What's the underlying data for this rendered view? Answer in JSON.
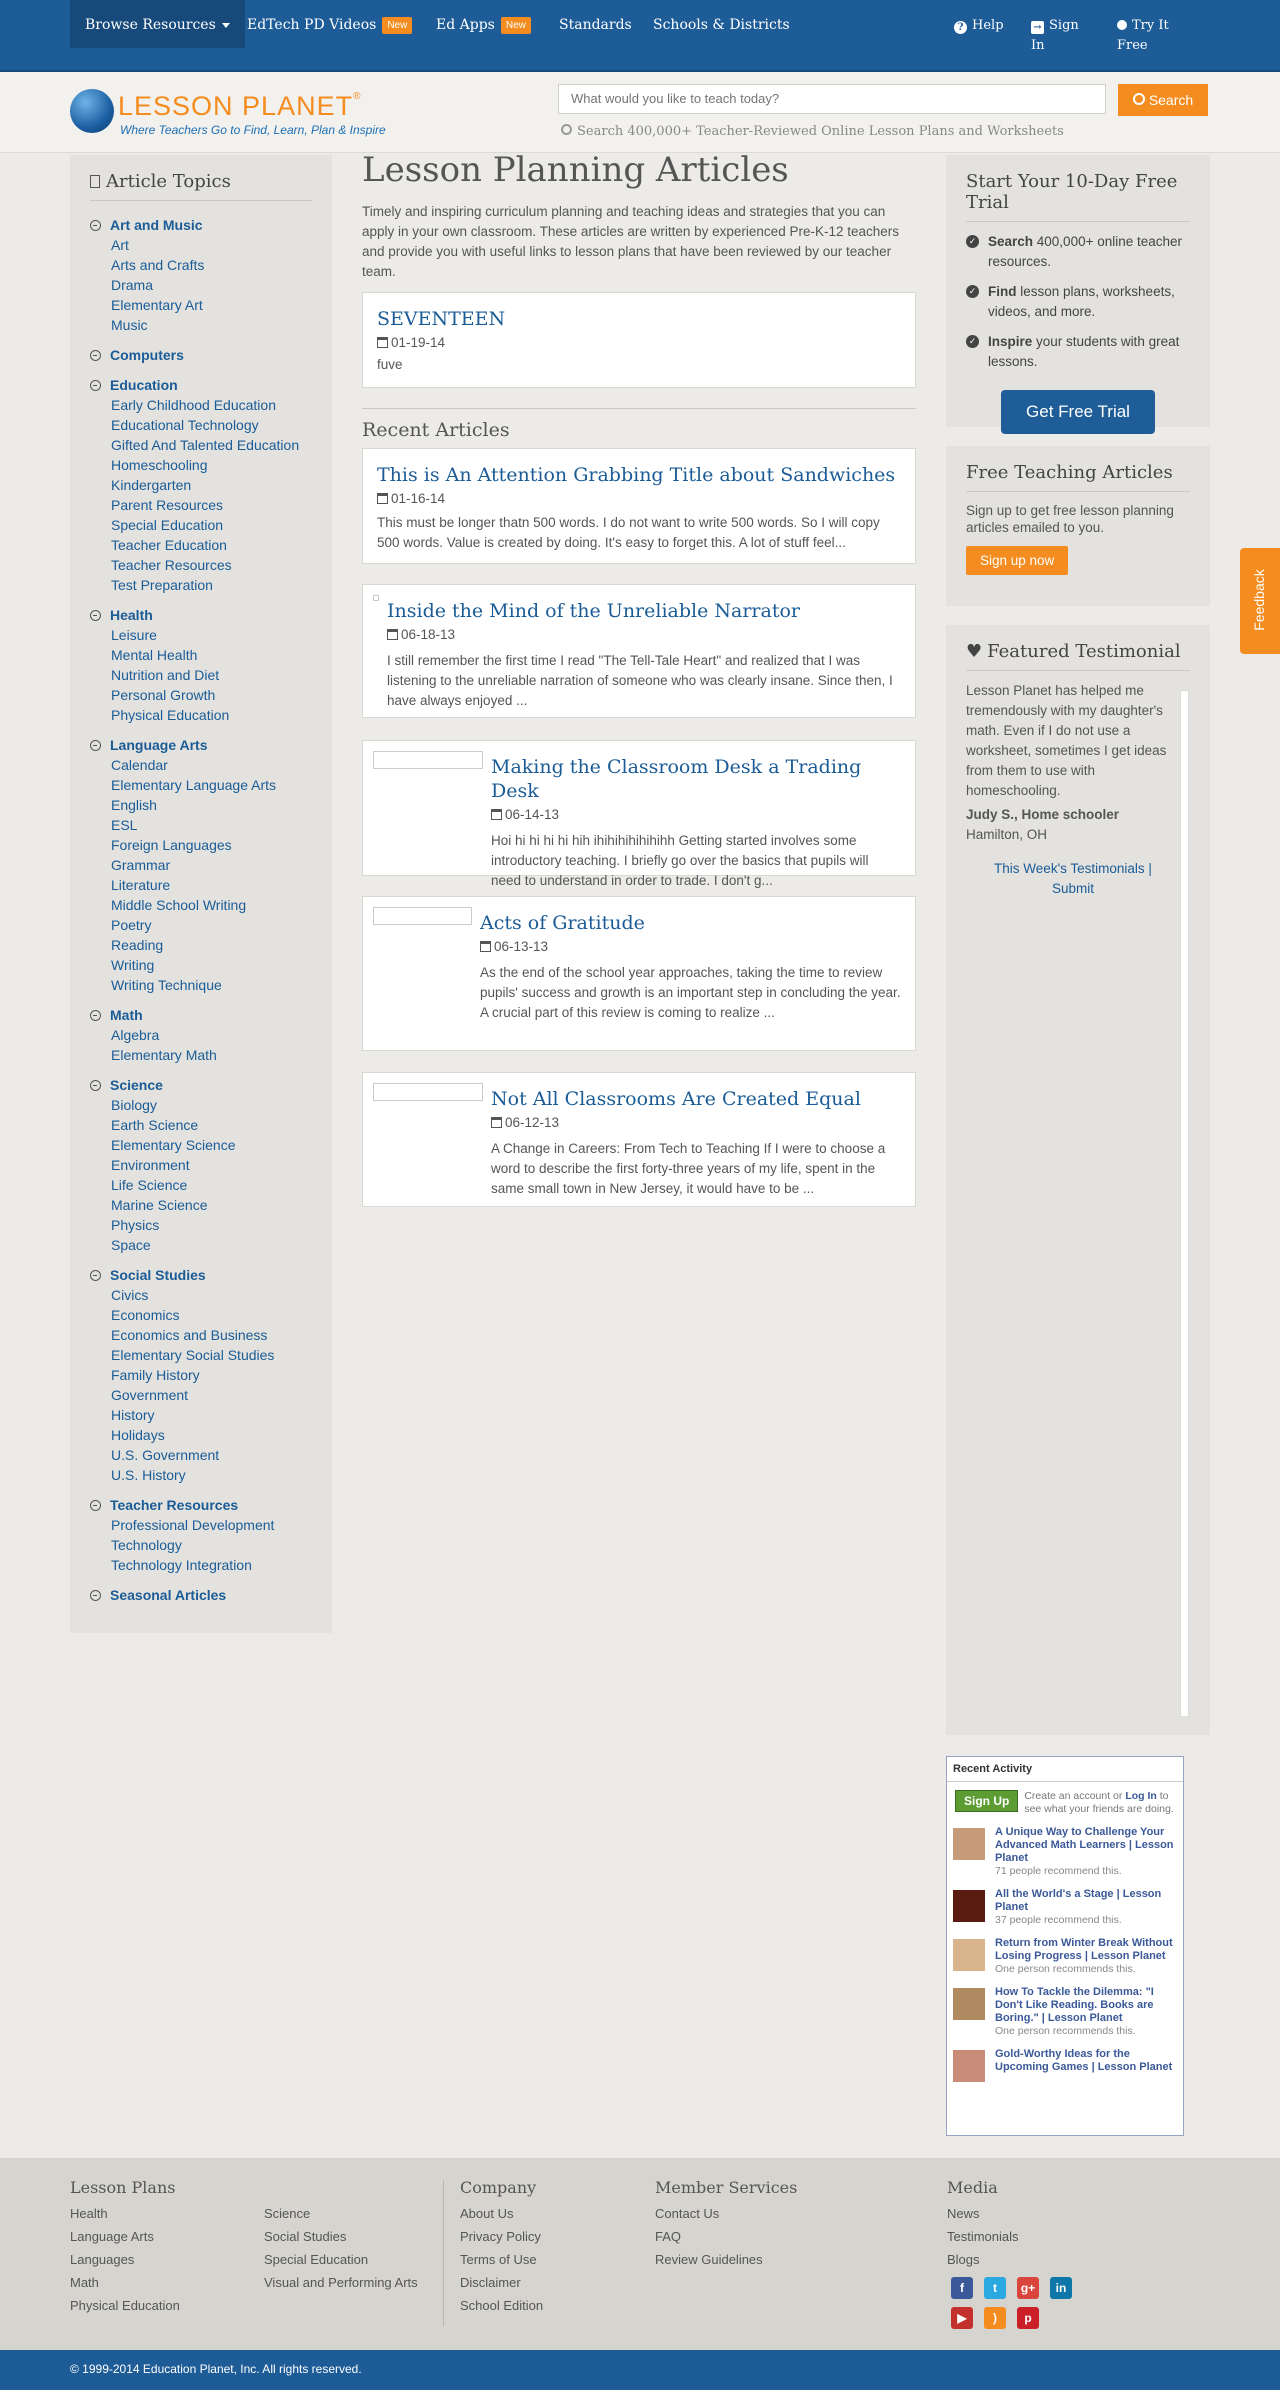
{
  "nav": {
    "browse": "Browse Resources",
    "edtech": "EdTech PD Videos",
    "edtech_badge": "New",
    "edapps": "Ed Apps",
    "edapps_badge": "New",
    "standards": "Standards",
    "schools": "Schools & Districts",
    "help": "Help",
    "signin_1": "Sign",
    "signin_2": "In",
    "trial_1": "Try It",
    "trial_2": "Free"
  },
  "header": {
    "logo_name": "LESSON PLANET",
    "logo_tagline": "Where Teachers Go to Find, Learn, Plan & Inspire",
    "search_placeholder": "What would you like to teach today?",
    "search_button": "Search",
    "search_hint": "Search 400,000+ Teacher-Reviewed Online Lesson Plans and Worksheets"
  },
  "sidebar": {
    "title": "Article Topics",
    "topics": [
      {
        "name": "Art and Music",
        "subs": [
          "Art",
          "Arts and Crafts",
          "Drama",
          "Elementary Art",
          "Music"
        ]
      },
      {
        "name": "Computers",
        "subs": []
      },
      {
        "name": "Education",
        "subs": [
          "Early Childhood Education",
          "Educational Technology",
          "Gifted And Talented Education",
          "Homeschooling",
          "Kindergarten",
          "Parent Resources",
          "Special Education",
          "Teacher Education",
          "Teacher Resources",
          "Test Preparation"
        ]
      },
      {
        "name": "Health",
        "subs": [
          "Leisure",
          "Mental Health",
          "Nutrition and Diet",
          "Personal Growth",
          "Physical Education"
        ]
      },
      {
        "name": "Language Arts",
        "subs": [
          "Calendar",
          "Elementary Language Arts",
          "English",
          "ESL",
          "Foreign Languages",
          "Grammar",
          "Literature",
          "Middle School Writing",
          "Poetry",
          "Reading",
          "Writing",
          "Writing Technique"
        ]
      },
      {
        "name": "Math",
        "subs": [
          "Algebra",
          "Elementary Math"
        ]
      },
      {
        "name": "Science",
        "subs": [
          "Biology",
          "Earth Science",
          "Elementary Science",
          "Environment",
          "Life Science",
          "Marine Science",
          "Physics",
          "Space"
        ]
      },
      {
        "name": "Social Studies",
        "subs": [
          "Civics",
          "Economics",
          "Economics and Business",
          "Elementary Social Studies",
          "Family History",
          "Government",
          "History",
          "Holidays",
          "U.S. Government",
          "U.S. History"
        ]
      },
      {
        "name": "Teacher Resources",
        "subs": [
          "Professional Development",
          "Technology",
          "Technology Integration"
        ]
      },
      {
        "name": "Seasonal Articles",
        "subs": []
      }
    ]
  },
  "main": {
    "title": "Lesson Planning Articles",
    "intro": "Timely and inspiring curriculum planning and teaching ideas and strategies that you can apply in your own classroom. These articles are written by experienced Pre-K-12 teachers and provide you with useful links to lesson plans that have been reviewed by our teacher team.",
    "featured": {
      "title": "SEVENTEEN",
      "date": "01-19-14",
      "body": "fuve"
    },
    "recent_heading": "Recent Articles",
    "articles": [
      {
        "title": "This is An Attention Grabbing Title about Sandwiches",
        "date": "01-16-14",
        "body": "This must be longer thatn 500 words. I do not want to write 500 words. So I will copy 500 words.    Value is created by doing. It's easy to forget this.  A lot of stuff feel..."
      },
      {
        "title": "Inside the Mind of the Unreliable Narrator",
        "date": "06-18-13",
        "body": "I still remember the first time I read \"The Tell-Tale Heart\" and realized that I was listening to the unreliable narration of someone who was clearly insane. Since then, I have always enjoyed ..."
      },
      {
        "title": "Making the Classroom Desk a Trading Desk",
        "date": "06-14-13",
        "body": "Hoi hi hi hi hi hih ihihihihihihihh   Getting started involves some introductory teaching. I briefly go over the basics that pupils will need to understand in order to trade. I don't g..."
      },
      {
        "title": "Acts of Gratitude",
        "date": "06-13-13",
        "body": "As the end of the school year approaches, taking the time to review pupils' success and growth is an important step in concluding the year. A crucial part of this review is coming to realize ..."
      },
      {
        "title": "Not All Classrooms Are Created Equal",
        "date": "06-12-13",
        "body": "A Change in Careers: From Tech to Teaching  If I were to choose a word to describe the first forty-three years of my life, spent in the same small town in New Jersey, it would have to be ..."
      }
    ]
  },
  "trial": {
    "title": "Start Your 10-Day Free Trial",
    "items": [
      {
        "bold": "Search",
        "rest": " 400,000+ online teacher resources."
      },
      {
        "bold": "Find",
        "rest": " lesson plans, worksheets, videos, and more."
      },
      {
        "bold": "Inspire",
        "rest": " your students with great lessons."
      }
    ],
    "button": "Get Free Trial"
  },
  "free_articles": {
    "title": "Free Teaching Articles",
    "text": "Sign up to get free lesson planning articles emailed to you.",
    "button": "Sign up now"
  },
  "feedback": "Feedback",
  "testimonial": {
    "title": "Featured Testimonial",
    "quote": "Lesson Planet has helped me tremendously with my daughter's math. Even if I do not use a worksheet, sometimes I get ideas from them to use with homeschooling.",
    "author": "Judy S., Home schooler",
    "location": "Hamilton, OH",
    "links_1": "This Week's Testimonials |",
    "links_2": "Submit"
  },
  "activity": {
    "title": "Recent Activity",
    "signup": "Sign Up",
    "create_text_1": "Create an account or ",
    "create_login": "Log In",
    "create_text_2": " to see what your friends are doing.",
    "items": [
      {
        "title": "A Unique Way to Challenge Your Advanced Math Learners | Lesson Planet",
        "count": "71 people recommend this."
      },
      {
        "title": "All the World's a Stage | Lesson Planet",
        "count": "37 people recommend this."
      },
      {
        "title": "Return from Winter Break Without Losing Progress | Lesson Planet",
        "count": "One person recommends this."
      },
      {
        "title": "How To Tackle the Dilemma: \"I Don't Like Reading. Books are Boring.\" | Lesson Planet",
        "count": "One person recommends this."
      },
      {
        "title": "Gold-Worthy Ideas for the Upcoming Games | Lesson Planet",
        "count": ""
      }
    ]
  },
  "footer": {
    "lesson_plans": {
      "title": "Lesson Plans",
      "col1": [
        "Health",
        "Language Arts",
        "Languages",
        "Math",
        "Physical Education"
      ],
      "col2": [
        "Science",
        "Social Studies",
        "Special Education",
        "Visual and Performing Arts"
      ]
    },
    "company": {
      "title": "Company",
      "links": [
        "About Us",
        "Privacy Policy",
        "Terms of Use",
        "Disclaimer",
        "School Edition"
      ]
    },
    "member": {
      "title": "Member Services",
      "links": [
        "Contact Us",
        "FAQ",
        "Review Guidelines"
      ]
    },
    "media": {
      "title": "Media",
      "links": [
        "News",
        "Testimonials",
        "Blogs"
      ]
    },
    "social": [
      {
        "name": "facebook-icon",
        "glyph": "f",
        "color": "#3b5998"
      },
      {
        "name": "twitter-icon",
        "glyph": "t",
        "color": "#2aa9e0"
      },
      {
        "name": "google-plus-icon",
        "glyph": "g+",
        "color": "#d9453d"
      },
      {
        "name": "linkedin-icon",
        "glyph": "in",
        "color": "#0e76a8"
      },
      {
        "name": "youtube-icon",
        "glyph": "▶",
        "color": "#c4302b"
      },
      {
        "name": "rss-icon",
        "glyph": ")",
        "color": "#f58c1f"
      },
      {
        "name": "pinterest-icon",
        "glyph": "p",
        "color": "#cb2027"
      }
    ],
    "copyright": "© 1999-2014 Education Planet, Inc. All rights reserved."
  }
}
